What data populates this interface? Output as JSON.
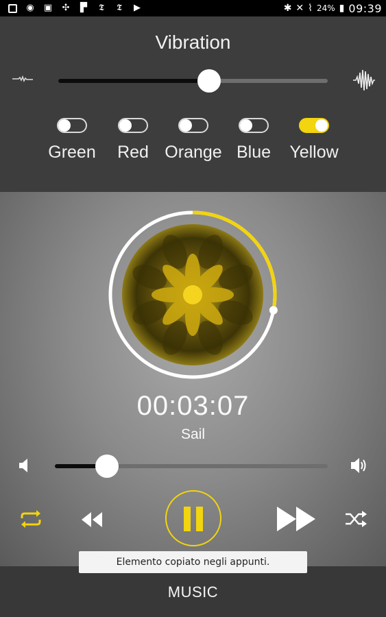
{
  "status_bar": {
    "left_icons": [
      "image-icon",
      "chrome-icon",
      "photo-icon",
      "pinwheel-icon",
      "flipboard-icon",
      "nytimes-icon",
      "nytimes-icon",
      "play-store-icon"
    ],
    "battery_percent": "24%",
    "time": "09:39"
  },
  "vibration": {
    "title": "Vibration",
    "level": 0.56
  },
  "color_toggles": [
    {
      "label": "Green",
      "on": false
    },
    {
      "label": "Red",
      "on": false
    },
    {
      "label": "Orange",
      "on": false
    },
    {
      "label": "Blue",
      "on": false
    },
    {
      "label": "Yellow",
      "on": true
    }
  ],
  "player": {
    "elapsed_time": "00:03:07",
    "song_title": "Sail",
    "track_progress": 0.28,
    "volume": 0.19
  },
  "toast": "Elemento copiato negli appunti.",
  "bottom_bar": {
    "title": "MUSIC"
  },
  "colors": {
    "accent": "#f2d40f",
    "panel": "#3d3d3d",
    "status_bar": "#000000"
  }
}
